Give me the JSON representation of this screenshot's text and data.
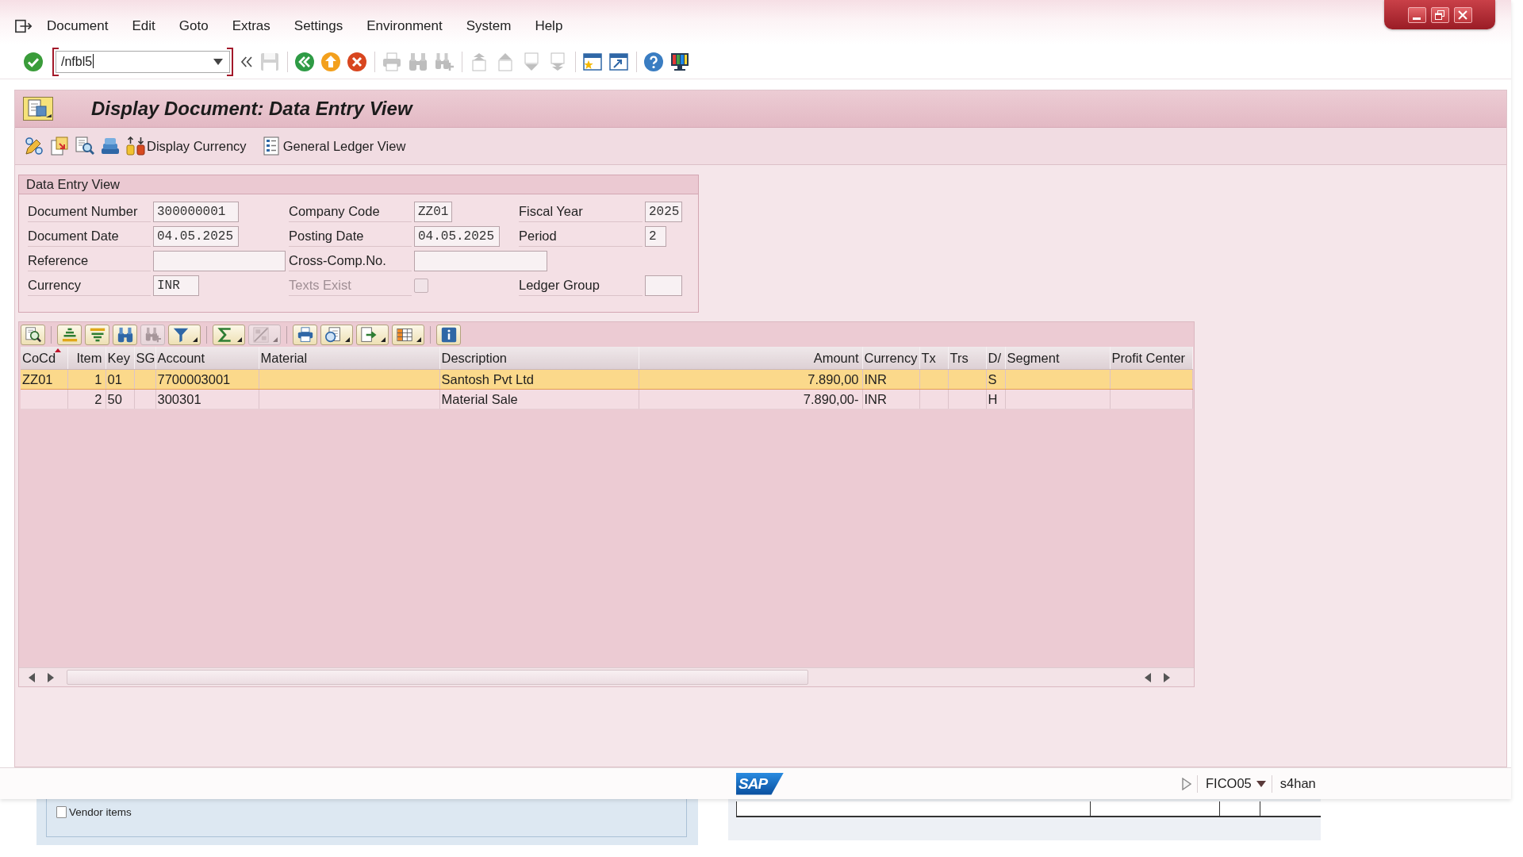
{
  "menu_bar": {
    "items": [
      "Document",
      "Edit",
      "Goto",
      "Extras",
      "Settings",
      "Environment",
      "System",
      "Help"
    ]
  },
  "toolbar": {
    "enter_button": {
      "disabled": false
    },
    "command_field": {
      "value": "/nfbl5",
      "focused": true
    },
    "groups": [
      [
        {
          "kind": "collapse",
          "disabled": false
        },
        {
          "kind": "save",
          "disabled": true
        }
      ],
      [
        {
          "kind": "back",
          "disabled": false
        },
        {
          "kind": "exit",
          "disabled": false
        },
        {
          "kind": "cancel",
          "disabled": false
        }
      ],
      [
        {
          "kind": "print",
          "disabled": true
        },
        {
          "kind": "find",
          "disabled": true
        },
        {
          "kind": "find_next",
          "disabled": true
        }
      ],
      [
        {
          "kind": "first_page",
          "disabled": true
        },
        {
          "kind": "previous_page",
          "disabled": true
        },
        {
          "kind": "next_page",
          "disabled": true
        },
        {
          "kind": "last_page",
          "disabled": true
        }
      ],
      [
        {
          "kind": "new_session",
          "disabled": false
        },
        {
          "kind": "shortcut",
          "disabled": false
        }
      ],
      [
        {
          "kind": "help",
          "disabled": false
        },
        {
          "kind": "layout",
          "disabled": false
        }
      ]
    ]
  },
  "title_bar": {
    "title": "Display Document: Data Entry View"
  },
  "application_toolbar": {
    "buttons": [
      {
        "kind": "display_change"
      },
      {
        "kind": "other_document"
      },
      {
        "kind": "document_search"
      },
      {
        "kind": "document_stack"
      },
      {
        "kind": "currency",
        "label": "Display Currency"
      },
      {
        "kind": "ledger_view",
        "label": "General Ledger View"
      }
    ]
  },
  "header_data": {
    "title": "Data Entry View",
    "rows": [
      [
        {
          "label": "Document Number",
          "kind": "field",
          "value": "300000001"
        },
        {
          "label": "Company Code",
          "kind": "field",
          "value": "ZZ01"
        },
        {
          "label": "Fiscal Year",
          "kind": "field",
          "value": "2025"
        }
      ],
      [
        {
          "label": "Document Date",
          "kind": "field",
          "value": "04.05.2025"
        },
        {
          "label": "Posting Date",
          "kind": "field",
          "value": "04.05.2025"
        },
        {
          "label": "Period",
          "kind": "field",
          "value": "2"
        }
      ],
      [
        {
          "label": "Reference",
          "kind": "field"
        },
        {
          "label": "Cross-Comp.No.",
          "kind": "field"
        }
      ],
      [
        {
          "label": "Currency",
          "kind": "field",
          "value": "INR"
        },
        {
          "label": "Texts Exist",
          "kind": "checkbox",
          "checked": false,
          "disabled": true
        },
        {
          "label": "Ledger Group",
          "kind": "field"
        }
      ]
    ]
  },
  "grid_toolbar": {
    "groups": [
      [
        {
          "kind": "details",
          "disabled": false,
          "menu": false
        }
      ],
      [
        {
          "kind": "sort_ascending",
          "disabled": false,
          "menu": false
        },
        {
          "kind": "sort_descending",
          "disabled": false,
          "menu": false
        },
        {
          "kind": "find",
          "disabled": false,
          "menu": false
        },
        {
          "kind": "find_next",
          "disabled": true,
          "menu": false
        },
        {
          "kind": "filter",
          "disabled": false,
          "menu": true
        }
      ],
      [
        {
          "kind": "total",
          "disabled": false,
          "menu": true
        },
        {
          "kind": "subtotal",
          "disabled": true,
          "menu": true
        }
      ],
      [
        {
          "kind": "print",
          "disabled": false,
          "menu": false
        },
        {
          "kind": "views",
          "disabled": false,
          "menu": true
        },
        {
          "kind": "export",
          "disabled": false,
          "menu": true
        },
        {
          "kind": "layout",
          "disabled": false,
          "menu": true
        }
      ],
      [
        {
          "kind": "information",
          "disabled": false,
          "menu": false
        }
      ]
    ]
  },
  "table": {
    "columns": [
      {
        "label": "CoCd",
        "sorted": true
      },
      {
        "label": "Item",
        "sorted": false
      },
      {
        "label": "Key",
        "sorted": false
      },
      {
        "label": "SG",
        "sorted": false
      },
      {
        "label": "Account",
        "sorted": false
      },
      {
        "label": "Material",
        "sorted": false
      },
      {
        "label": "Description",
        "sorted": false
      },
      {
        "label": "Amount",
        "sorted": false
      },
      {
        "label": "Currency",
        "sorted": false
      },
      {
        "label": "Tx",
        "sorted": false
      },
      {
        "label": "Trs",
        "sorted": false
      },
      {
        "label": "D/",
        "sorted": false
      },
      {
        "label": "Segment",
        "sorted": false
      },
      {
        "label": "Profit Center",
        "sorted": false
      }
    ],
    "rows": [
      {
        "selected": true,
        "company_code": "ZZ01",
        "item": "1",
        "posting_key": "01",
        "account": "7700003001",
        "description": "Santosh Pvt Ltd",
        "amount": "7.890,00",
        "currency": "INR",
        "column_12": "S"
      },
      {
        "selected": false,
        "item": "2",
        "posting_key": "50",
        "account": "300301",
        "description": "Material Sale",
        "amount": "7.890,00-",
        "currency": "INR",
        "column_12": "H"
      }
    ]
  },
  "status_bar": {
    "logo": "SAP",
    "system": "FICO05",
    "server": "s4han"
  },
  "background_window": {
    "checkboxes": [
      {
        "label": "Vendor items",
        "checked": false
      }
    ]
  }
}
